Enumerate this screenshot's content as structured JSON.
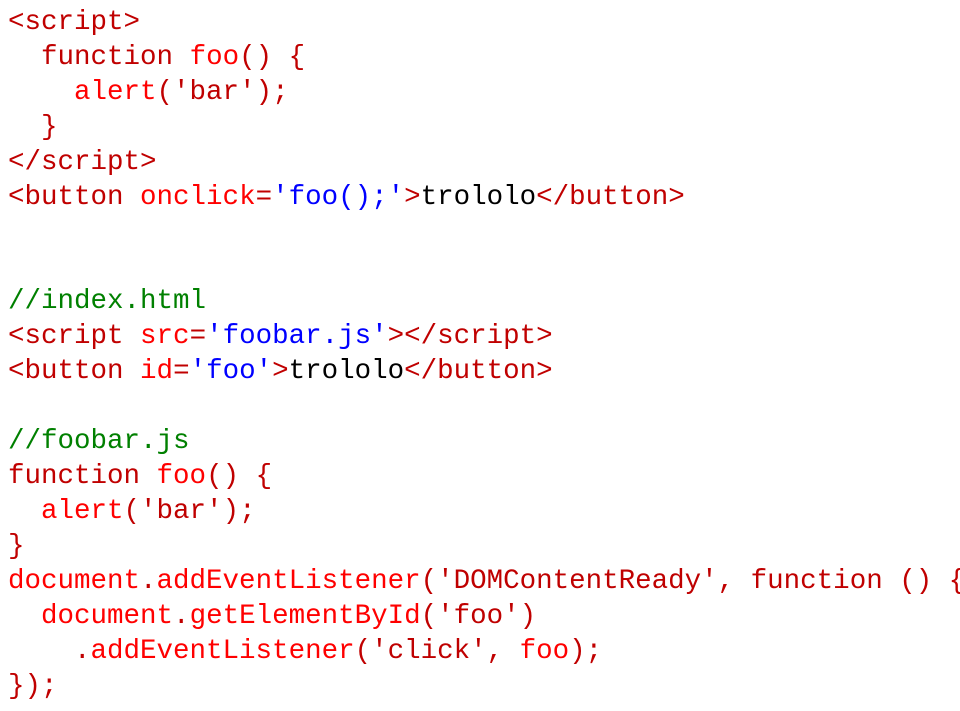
{
  "block1": {
    "l1a": "<script>",
    "l2a": "function",
    "l2b": "foo",
    "l3a": "alert",
    "l3b": "'bar'",
    "l5a": "</script>",
    "l6a": "<button",
    "l6b": "onclick",
    "l6c": "'foo();'",
    "l6d": "trololo",
    "l6e": "</button>"
  },
  "block2": {
    "c1": "//index.html",
    "l1a": "<script",
    "l1b": "src",
    "l1c": "'foobar.js'",
    "l1d": "></script>",
    "l2a": "<button",
    "l2b": "id",
    "l2c": "'foo'",
    "l2d": "trololo",
    "l2e": "</button>"
  },
  "block3": {
    "c1": "//foobar.js",
    "l1a": "function",
    "l1b": "foo",
    "l2a": "alert",
    "l2b": "'bar'",
    "l4a": "document",
    "l4b": "addEventListener",
    "l4c": "'DOMContentReady'",
    "l4d": "function",
    "l5a": "document",
    "l5b": "getElementById",
    "l5c": "'foo'",
    "l6a": "addEventListener",
    "l6b": "'click'",
    "l6c": "foo"
  }
}
